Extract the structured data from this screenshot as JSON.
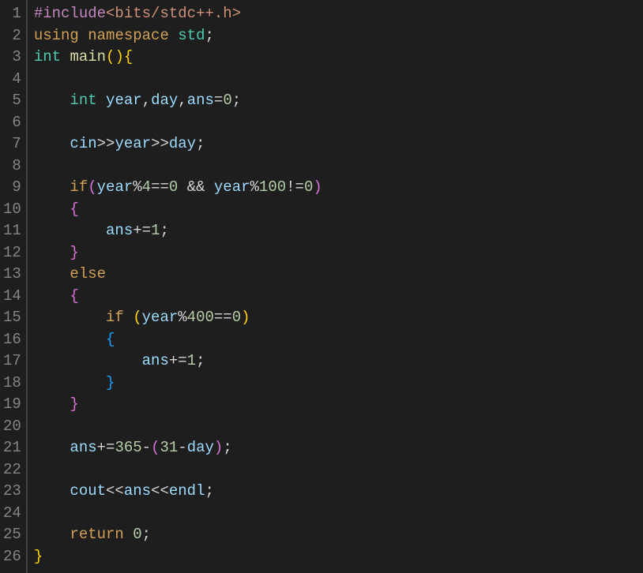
{
  "lineCount": 26,
  "lines": [
    [
      {
        "cls": "tok-include",
        "t": "#include"
      },
      {
        "cls": "tok-anglefile",
        "t": "<bits/stdc++.h>"
      }
    ],
    [
      {
        "cls": "tok-keyword",
        "t": "using"
      },
      {
        "cls": "tok-var",
        "t": " "
      },
      {
        "cls": "tok-keyword",
        "t": "namespace"
      },
      {
        "cls": "tok-var",
        "t": " "
      },
      {
        "cls": "tok-stdid",
        "t": "std"
      },
      {
        "cls": "tok-semicolon",
        "t": ";"
      }
    ],
    [
      {
        "cls": "tok-type",
        "t": "int"
      },
      {
        "cls": "tok-var",
        "t": " "
      },
      {
        "cls": "tok-func",
        "t": "main"
      },
      {
        "cls": "tok-paren",
        "t": "()"
      },
      {
        "cls": "tok-brace",
        "t": "{"
      }
    ],
    [],
    [
      {
        "cls": "tok-var",
        "t": "    "
      },
      {
        "cls": "tok-type",
        "t": "int"
      },
      {
        "cls": "tok-var",
        "t": " "
      },
      {
        "cls": "tok-ident",
        "t": "year"
      },
      {
        "cls": "tok-punct",
        "t": ","
      },
      {
        "cls": "tok-ident",
        "t": "day"
      },
      {
        "cls": "tok-punct",
        "t": ","
      },
      {
        "cls": "tok-ident",
        "t": "ans"
      },
      {
        "cls": "tok-op",
        "t": "="
      },
      {
        "cls": "tok-number",
        "t": "0"
      },
      {
        "cls": "tok-semicolon",
        "t": ";"
      }
    ],
    [],
    [
      {
        "cls": "tok-var",
        "t": "    "
      },
      {
        "cls": "tok-ident",
        "t": "cin"
      },
      {
        "cls": "tok-op",
        "t": ">>"
      },
      {
        "cls": "tok-ident",
        "t": "year"
      },
      {
        "cls": "tok-op",
        "t": ">>"
      },
      {
        "cls": "tok-ident",
        "t": "day"
      },
      {
        "cls": "tok-semicolon",
        "t": ";"
      }
    ],
    [],
    [
      {
        "cls": "tok-var",
        "t": "    "
      },
      {
        "cls": "tok-control",
        "t": "if"
      },
      {
        "cls": "tok-paren2",
        "t": "("
      },
      {
        "cls": "tok-ident",
        "t": "year"
      },
      {
        "cls": "tok-op",
        "t": "%"
      },
      {
        "cls": "tok-number",
        "t": "4"
      },
      {
        "cls": "tok-op",
        "t": "=="
      },
      {
        "cls": "tok-number",
        "t": "0"
      },
      {
        "cls": "tok-var",
        "t": " "
      },
      {
        "cls": "tok-op",
        "t": "&&"
      },
      {
        "cls": "tok-var",
        "t": " "
      },
      {
        "cls": "tok-ident",
        "t": "year"
      },
      {
        "cls": "tok-op",
        "t": "%"
      },
      {
        "cls": "tok-number",
        "t": "100"
      },
      {
        "cls": "tok-op",
        "t": "!="
      },
      {
        "cls": "tok-number",
        "t": "0"
      },
      {
        "cls": "tok-paren2",
        "t": ")"
      }
    ],
    [
      {
        "cls": "tok-var",
        "t": "    "
      },
      {
        "cls": "tok-brace2",
        "t": "{"
      }
    ],
    [
      {
        "cls": "tok-var",
        "t": "        "
      },
      {
        "cls": "tok-ident",
        "t": "ans"
      },
      {
        "cls": "tok-op",
        "t": "+="
      },
      {
        "cls": "tok-number",
        "t": "1"
      },
      {
        "cls": "tok-semicolon",
        "t": ";"
      }
    ],
    [
      {
        "cls": "tok-var",
        "t": "    "
      },
      {
        "cls": "tok-brace2",
        "t": "}"
      }
    ],
    [
      {
        "cls": "tok-var",
        "t": "    "
      },
      {
        "cls": "tok-control",
        "t": "else"
      }
    ],
    [
      {
        "cls": "tok-var",
        "t": "    "
      },
      {
        "cls": "tok-brace2",
        "t": "{"
      }
    ],
    [
      {
        "cls": "tok-var",
        "t": "        "
      },
      {
        "cls": "tok-control",
        "t": "if"
      },
      {
        "cls": "tok-var",
        "t": " "
      },
      {
        "cls": "tok-paren",
        "t": "("
      },
      {
        "cls": "tok-ident",
        "t": "year"
      },
      {
        "cls": "tok-op",
        "t": "%"
      },
      {
        "cls": "tok-number",
        "t": "400"
      },
      {
        "cls": "tok-op",
        "t": "=="
      },
      {
        "cls": "tok-number",
        "t": "0"
      },
      {
        "cls": "tok-paren",
        "t": ")"
      }
    ],
    [
      {
        "cls": "tok-var",
        "t": "        "
      },
      {
        "cls": "tok-brace3",
        "t": "{"
      }
    ],
    [
      {
        "cls": "tok-var",
        "t": "            "
      },
      {
        "cls": "tok-ident",
        "t": "ans"
      },
      {
        "cls": "tok-op",
        "t": "+="
      },
      {
        "cls": "tok-number",
        "t": "1"
      },
      {
        "cls": "tok-semicolon",
        "t": ";"
      }
    ],
    [
      {
        "cls": "tok-var",
        "t": "        "
      },
      {
        "cls": "tok-brace3",
        "t": "}"
      }
    ],
    [
      {
        "cls": "tok-var",
        "t": "    "
      },
      {
        "cls": "tok-brace2",
        "t": "}"
      }
    ],
    [],
    [
      {
        "cls": "tok-var",
        "t": "    "
      },
      {
        "cls": "tok-ident",
        "t": "ans"
      },
      {
        "cls": "tok-op",
        "t": "+="
      },
      {
        "cls": "tok-number",
        "t": "365"
      },
      {
        "cls": "tok-op",
        "t": "-"
      },
      {
        "cls": "tok-paren2",
        "t": "("
      },
      {
        "cls": "tok-number",
        "t": "31"
      },
      {
        "cls": "tok-op",
        "t": "-"
      },
      {
        "cls": "tok-ident",
        "t": "day"
      },
      {
        "cls": "tok-paren2",
        "t": ")"
      },
      {
        "cls": "tok-semicolon",
        "t": ";"
      }
    ],
    [],
    [
      {
        "cls": "tok-var",
        "t": "    "
      },
      {
        "cls": "tok-ident",
        "t": "cout"
      },
      {
        "cls": "tok-op",
        "t": "<<"
      },
      {
        "cls": "tok-ident",
        "t": "ans"
      },
      {
        "cls": "tok-op",
        "t": "<<"
      },
      {
        "cls": "tok-ident",
        "t": "endl"
      },
      {
        "cls": "tok-semicolon",
        "t": ";"
      }
    ],
    [],
    [
      {
        "cls": "tok-var",
        "t": "    "
      },
      {
        "cls": "tok-control",
        "t": "return"
      },
      {
        "cls": "tok-var",
        "t": " "
      },
      {
        "cls": "tok-number",
        "t": "0"
      },
      {
        "cls": "tok-semicolon",
        "t": ";"
      }
    ],
    [
      {
        "cls": "tok-brace",
        "t": "}"
      }
    ]
  ]
}
